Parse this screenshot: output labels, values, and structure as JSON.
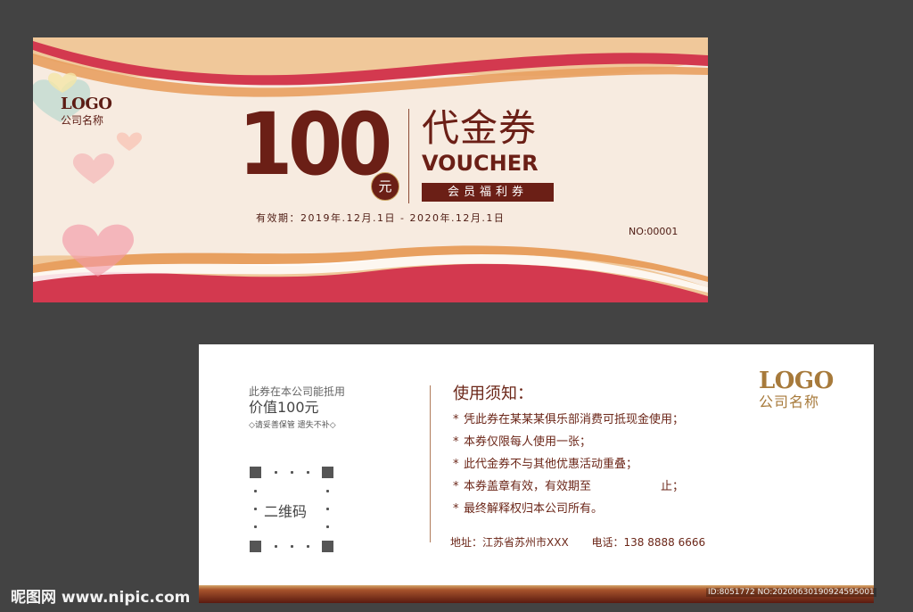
{
  "front": {
    "logo_text": "LOGO",
    "company": "公司名称",
    "amount": "100",
    "currency": "元",
    "title_cn": "代金券",
    "title_en": "VOUCHER",
    "tag": "会员福利券",
    "validity": "有效期：2019年.12月.1日 - 2020年.12月.1日",
    "serial": "NO:00001"
  },
  "back": {
    "line1": "此券在本公司能抵用",
    "line2": "价值100元",
    "line3": "◇请妥善保管 遗失不补◇",
    "qr_label": "二维码",
    "rules_title": "使用须知：",
    "rules": [
      "凭此券在某某某俱乐部消费可抵现金使用；",
      "本券仅限每人使用一张；",
      "此代金券不与其他优惠活动重叠；",
      "本券盖章有效，有效期至",
      "最终解释权归本公司所有。"
    ],
    "rule4_end": "止；",
    "bullet": "*",
    "address": "地址：江苏省苏州市XXX",
    "phone": "电话：138 8888 6666",
    "logo_text": "LOGO",
    "company": "公司名称"
  },
  "watermark": {
    "site": "昵图网 www.nipic.com",
    "id": "ID:8051772 NO:20200630190924595001"
  },
  "colors": {
    "background": "#434343",
    "maroon": "#6b1f16",
    "gold": "#a77a3b",
    "cream": "#f7ebe0",
    "wave_red": "#d3394f",
    "wave_orange": "#e8a060"
  }
}
